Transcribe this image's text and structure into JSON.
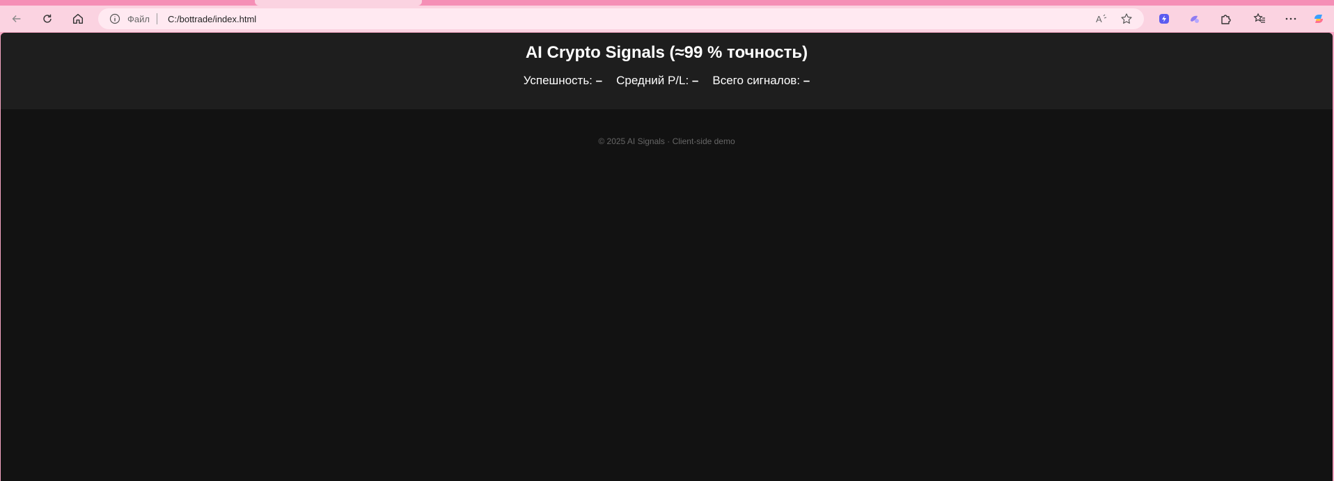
{
  "browser": {
    "address_scheme": "Файл",
    "address_url": "C:/bottrade/index.html"
  },
  "page": {
    "title": "AI Crypto Signals (≈99 % точность)",
    "stats": [
      {
        "label": "Успешность:",
        "value": "–"
      },
      {
        "label": "Средний P/L:",
        "value": "–"
      },
      {
        "label": "Всего сигналов:",
        "value": "–"
      }
    ],
    "footer": "© 2025 AI Signals · Client-side demo"
  },
  "colors": {
    "browser_frame": "#f6a6c3",
    "toolbar": "#fbd3e1",
    "page_background": "#121212",
    "header_background": "#1e1e1e"
  }
}
